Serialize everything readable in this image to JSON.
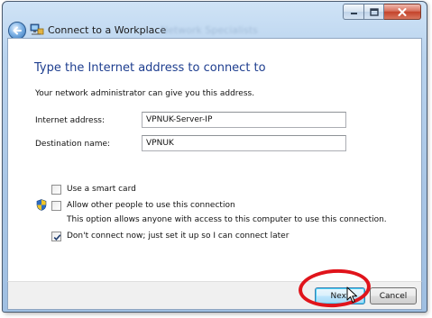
{
  "window": {
    "title": "Connect to a Workplace",
    "ghost_title": "Network Specialists"
  },
  "page": {
    "heading": "Type the Internet address to connect to",
    "instruction": "Your network administrator can give you this address."
  },
  "form": {
    "internet_address": {
      "label": "Internet address:",
      "value": "VPNUK-Server-IP"
    },
    "destination_name": {
      "label": "Destination name:",
      "value": "VPNUK"
    }
  },
  "options": {
    "smart_card": {
      "label": "Use a smart card",
      "checked": false
    },
    "allow_others": {
      "label": "Allow other people to use this connection",
      "description": "This option allows anyone with access to this computer to use this connection.",
      "checked": false
    },
    "dont_connect": {
      "label": "Don't connect now; just set it up so I can connect later",
      "checked": true
    }
  },
  "buttons": {
    "next": "Next",
    "cancel": "Cancel"
  },
  "icons": {
    "back": "back-arrow-icon",
    "wizard": "network-connection-icon",
    "shield": "uac-shield-icon",
    "cursor": "mouse-pointer-icon"
  },
  "colors": {
    "heading": "#1e3e8f",
    "highlight_ring": "#e0141b",
    "close_button": "#c4432b"
  }
}
